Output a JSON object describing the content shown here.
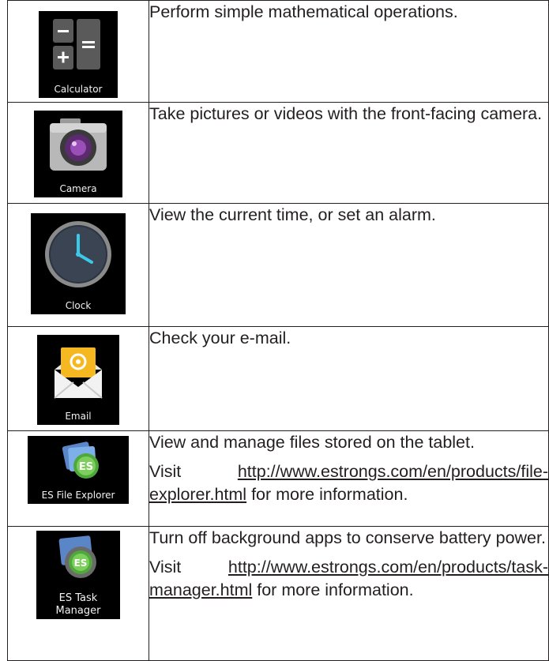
{
  "apps": [
    {
      "label": "Calculator",
      "icon": "calculator-icon",
      "description": "Perform simple mathematical operations."
    },
    {
      "label": "Camera",
      "icon": "camera-icon",
      "description": "Take pictures or videos with the front-facing camera."
    },
    {
      "label": "Clock",
      "icon": "clock-icon",
      "description": "View the current time, or set an alarm."
    },
    {
      "label": "Email",
      "icon": "email-icon",
      "description": "Check your e-mail."
    },
    {
      "label": "ES File Explorer",
      "icon": "es-file-explorer-icon",
      "description": "View and manage files stored on the tablet.",
      "visit_prefix": "Visit",
      "url": "http://www.estrongs.com/en/products/file-explorer.html",
      "visit_suffix": "for more information."
    },
    {
      "label": "ES Task Manager",
      "icon": "es-task-manager-icon",
      "description": "Turn off background apps to conserve battery power.",
      "visit_prefix": "Visit",
      "url": "http://www.estrongs.com/en/products/task-manager.html",
      "visit_suffix": "for more information."
    }
  ]
}
